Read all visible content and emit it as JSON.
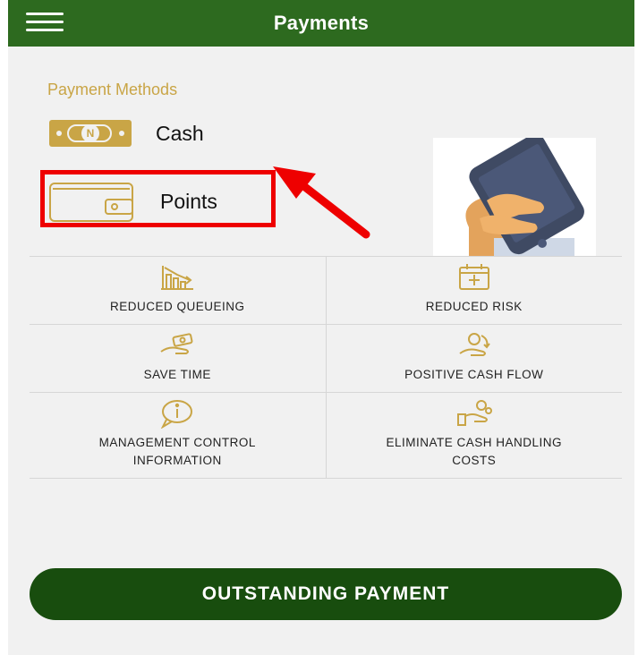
{
  "header": {
    "title": "Payments",
    "menu_icon": "hamburger-menu-icon",
    "background_color": "#2d6a1f"
  },
  "payment_methods": {
    "section_label": "Payment Methods",
    "label_color": "#c9a546",
    "items": [
      {
        "label": "Cash",
        "icon": "cash-note-icon",
        "icon_text": "N"
      },
      {
        "label": "Points",
        "icon": "wallet-icon",
        "highlighted": true
      }
    ]
  },
  "annotation": {
    "highlight_color": "#ee0000",
    "arrow_target": "Points"
  },
  "illustration": {
    "icon": "hand-holding-phone-illustration"
  },
  "features": [
    {
      "label": "REDUCED QUEUEING",
      "icon": "declining-chart-icon"
    },
    {
      "label": "REDUCED RISK",
      "icon": "calendar-risk-icon"
    },
    {
      "label": "SAVE TIME",
      "icon": "hand-money-icon"
    },
    {
      "label": "POSITIVE CASH FLOW",
      "icon": "cash-flow-icon"
    },
    {
      "label": "MANAGEMENT CONTROL\nINFORMATION",
      "icon": "info-bubble-icon"
    },
    {
      "label": "ELIMINATE CASH HANDLING\nCOSTS",
      "icon": "hand-coins-icon"
    }
  ],
  "footer": {
    "button_label": "OUTSTANDING PAYMENT",
    "button_color": "#184d0e"
  }
}
